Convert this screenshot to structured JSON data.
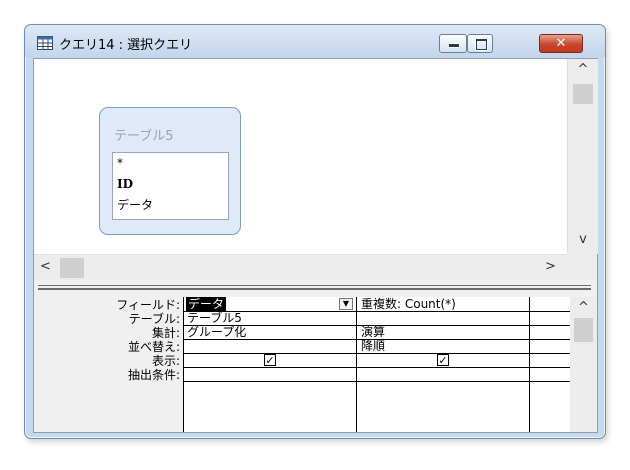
{
  "window": {
    "title": "クエリ14 : 選択クエリ",
    "close_glyph": "✕"
  },
  "table_box": {
    "title": "テーブル5",
    "fields": [
      "*",
      "ID",
      "データ"
    ]
  },
  "grid": {
    "row_labels": [
      "フィールド:",
      "テーブル:",
      "集計:",
      "並べ替え:",
      "表示:",
      "抽出条件:"
    ],
    "columns": [
      {
        "field": "データ",
        "table": "テーブル5",
        "total": "グループ化",
        "sort": "",
        "show": true,
        "criteria": ""
      },
      {
        "field": "重複数: Count(*)",
        "table": "",
        "total": "演算",
        "sort": "降順",
        "show": true,
        "criteria": ""
      }
    ],
    "dropdown_glyph": "▼",
    "check_glyph": "✓"
  },
  "scroll": {
    "up": "^",
    "down": "v",
    "left": "<",
    "right": ">"
  },
  "colors": {
    "title_bar": "#c7d9ee",
    "close_button": "#c7462d",
    "table_box": "#dfe9f7"
  }
}
